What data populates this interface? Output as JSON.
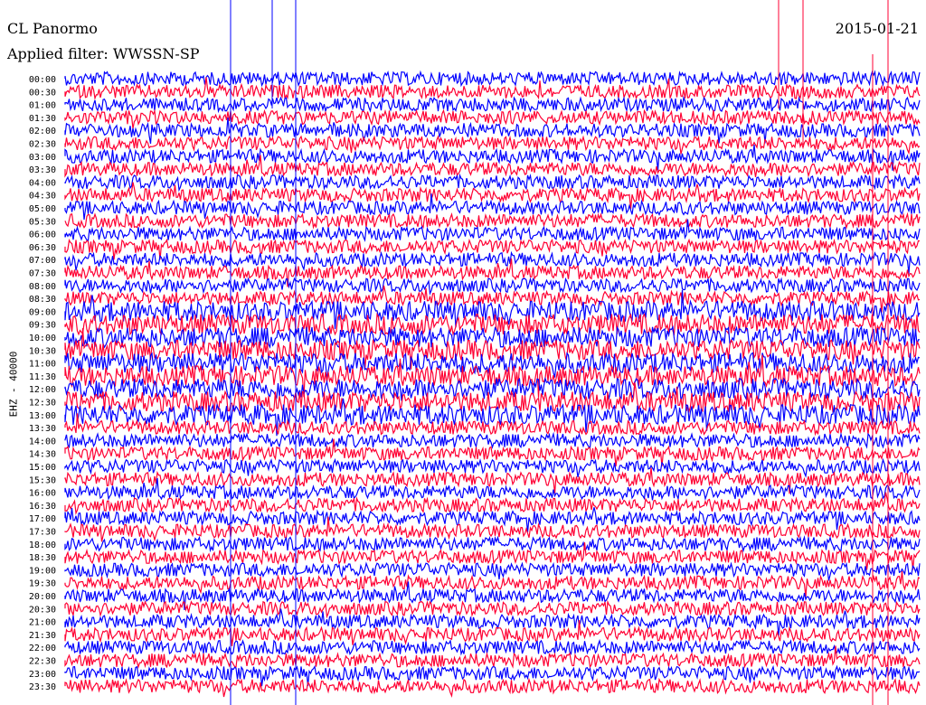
{
  "header": {
    "station": "CL Panormo",
    "filter_text": "Applied filter: WWSSN-SP",
    "date": "2015-01-21"
  },
  "chart_data": {
    "type": "line",
    "ylabel": "EHZ - 40000",
    "row_labels": [
      "00:00",
      "00:30",
      "01:00",
      "01:30",
      "02:00",
      "02:30",
      "03:00",
      "03:30",
      "04:00",
      "04:30",
      "05:00",
      "05:30",
      "06:00",
      "06:30",
      "07:00",
      "07:30",
      "08:00",
      "08:30",
      "09:00",
      "09:30",
      "10:00",
      "10:30",
      "11:00",
      "11:30",
      "12:00",
      "12:30",
      "13:00",
      "13:30",
      "14:00",
      "14:30",
      "15:00",
      "15:30",
      "16:00",
      "16:30",
      "17:00",
      "17:30",
      "18:00",
      "18:30",
      "19:00",
      "19:30",
      "20:00",
      "20:30",
      "21:00",
      "21:30",
      "22:00",
      "22:30",
      "23:00",
      "23:30"
    ],
    "series_colors": [
      "#0000ff",
      "#ff0033"
    ],
    "grid": false
  }
}
